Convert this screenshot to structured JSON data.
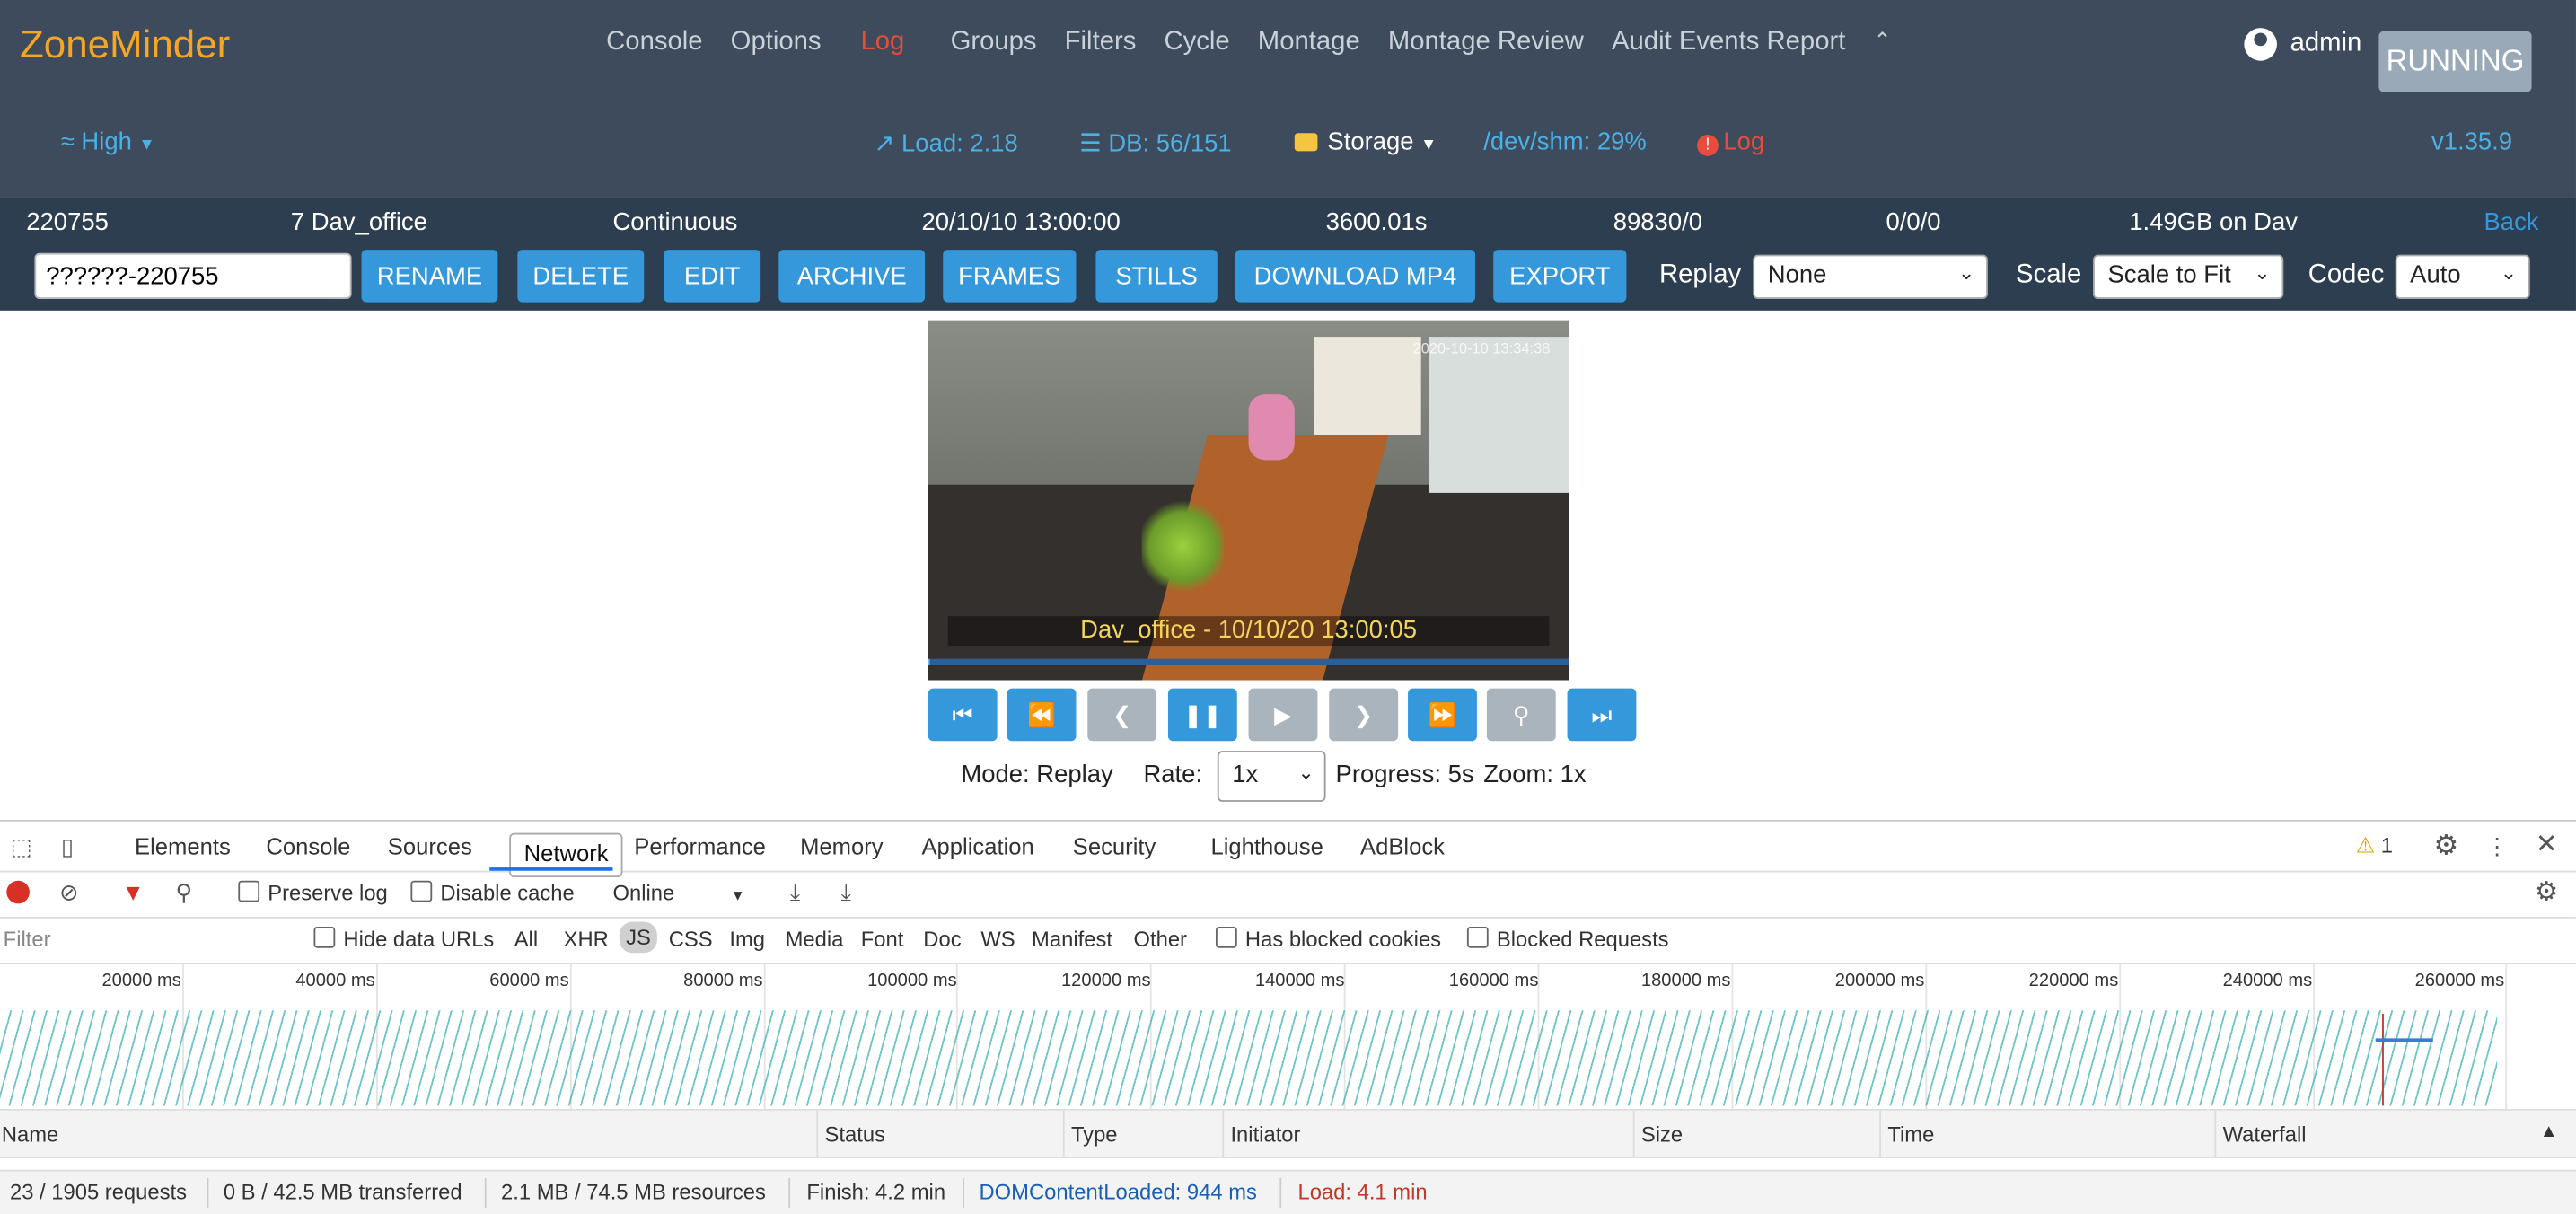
{
  "brand": "ZoneMinder",
  "nav": {
    "items": [
      "Console",
      "Options",
      "Log",
      "Groups",
      "Filters",
      "Cycle",
      "Montage",
      "Montage Review",
      "Audit Events Report"
    ],
    "active": "Log",
    "collapse_icon": "chevron-up-icon"
  },
  "user": {
    "name": "admin",
    "icon": "user-circle-icon"
  },
  "state": "RUNNING",
  "sysbar": {
    "bandwidth": "High",
    "load": "Load: 2.18",
    "db": "DB: 56/151",
    "storage": "Storage",
    "shm": "/dev/shm: 29%",
    "log": "Log",
    "version": "v1.35.9"
  },
  "event": {
    "id": "220755",
    "monitor": "7 Dav_office",
    "cause": "Continuous",
    "datetime": "20/10/10 13:00:00",
    "duration": "3600.01s",
    "frames": "89830/0",
    "score": "0/0/0",
    "storage": "1.49GB on Dav",
    "back": "Back",
    "name_value": "??????-220755"
  },
  "actions": [
    "RENAME",
    "DELETE",
    "EDIT",
    "ARCHIVE",
    "FRAMES",
    "STILLS",
    "DOWNLOAD MP4",
    "EXPORT"
  ],
  "controls": {
    "replay_label": "Replay",
    "replay_value": "None",
    "scale_label": "Scale",
    "scale_value": "Scale to Fit",
    "codec_label": "Codec",
    "codec_value": "Auto"
  },
  "video": {
    "caption": "Dav_office - 10/10/20 13:00:05",
    "overlay_ts": "2020-10-10 13:34:38",
    "progress_fraction": 0.0014
  },
  "player": {
    "buttons": [
      {
        "icon": "skip-start-icon",
        "enabled": true
      },
      {
        "icon": "fast-backward-icon",
        "enabled": true
      },
      {
        "icon": "step-back-icon",
        "enabled": false
      },
      {
        "icon": "pause-icon",
        "enabled": true
      },
      {
        "icon": "play-icon",
        "enabled": false
      },
      {
        "icon": "step-forward-icon",
        "enabled": false
      },
      {
        "icon": "fast-forward-icon",
        "enabled": true
      },
      {
        "icon": "zoom-out-icon",
        "enabled": false
      },
      {
        "icon": "skip-end-icon",
        "enabled": true
      }
    ],
    "mode": "Mode: Replay",
    "rate_label": "Rate:",
    "rate_value": "1x",
    "progress": "Progress: 5s",
    "zoom": "Zoom: 1x"
  },
  "devtools": {
    "tabs": [
      "Elements",
      "Console",
      "Sources",
      "Network",
      "Performance",
      "Memory",
      "Application",
      "Security",
      "Lighthouse",
      "AdBlock"
    ],
    "selected_tab": "Network",
    "warnings": "1",
    "toolbar": {
      "preserve_log": "Preserve log",
      "disable_cache": "Disable cache",
      "throttle": "Online"
    },
    "filter": {
      "placeholder": "Filter",
      "hide_data_urls": "Hide data URLs",
      "types": [
        "All",
        "XHR",
        "JS",
        "CSS",
        "Img",
        "Media",
        "Font",
        "Doc",
        "WS",
        "Manifest",
        "Other"
      ],
      "selected_type": "JS",
      "has_blocked_cookies": "Has blocked cookies",
      "blocked_requests": "Blocked Requests"
    },
    "timeline_ticks": [
      "20000 ms",
      "40000 ms",
      "60000 ms",
      "80000 ms",
      "100000 ms",
      "120000 ms",
      "140000 ms",
      "160000 ms",
      "180000 ms",
      "200000 ms",
      "220000 ms",
      "240000 ms",
      "260000 ms"
    ],
    "columns": [
      "Name",
      "Status",
      "Type",
      "Initiator",
      "Size",
      "Time",
      "Waterfall"
    ],
    "status": {
      "requests": "23 / 1905 requests",
      "transferred": "0 B / 42.5 MB transferred",
      "resources": "2.1 MB / 74.5 MB resources",
      "finish": "Finish: 4.2 min",
      "dom": "DOMContentLoaded: 944 ms",
      "load": "Load: 4.1 min"
    }
  }
}
